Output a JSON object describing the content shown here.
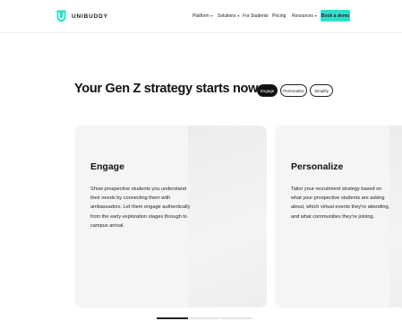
{
  "header": {
    "brand": "UNIBUDDY",
    "nav": [
      {
        "label": "Platform",
        "has_dropdown": true
      },
      {
        "label": "Solutions",
        "has_dropdown": true
      },
      {
        "label": "For Students",
        "has_dropdown": false
      },
      {
        "label": "Pricing",
        "has_dropdown": false
      },
      {
        "label": "Resources",
        "has_dropdown": true
      }
    ],
    "cta_label": "Book a demo",
    "cta_color": "#2ee0c9"
  },
  "hero": {
    "headline": "Your Gen Z strategy starts now",
    "tabs": [
      {
        "label": "Engage",
        "active": true
      },
      {
        "label": "Personalize",
        "active": false
      },
      {
        "label": "Simplify",
        "active": false
      }
    ]
  },
  "cards": [
    {
      "title": "Engage",
      "body": "Show prospective students you understand their needs by connecting them with ambassadors. Let them engage authentically from the early exploration stages through to campus arrival."
    },
    {
      "title": "Personalize",
      "body": "Tailor your recruitment strategy based on what your prospective students are asking about, which virtual events they're attending, and what communities they're joining."
    }
  ],
  "pager": {
    "count": 3,
    "active_index": 0
  },
  "icons": {
    "logo": "shield-logo-icon",
    "dropdown": "chevron-down-icon"
  }
}
